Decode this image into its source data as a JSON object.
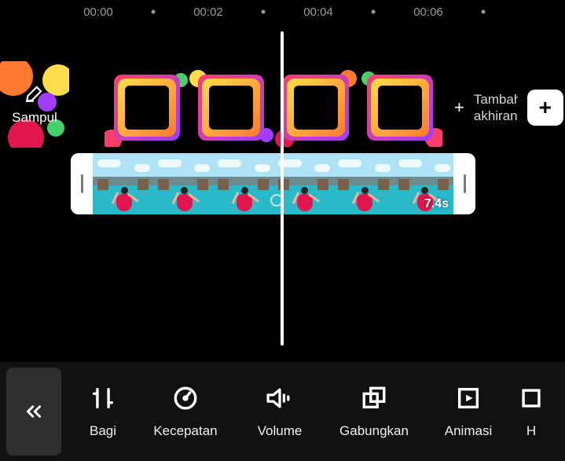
{
  "ruler": {
    "labels": [
      "00:00",
      "00:02",
      "00:04",
      "00:06"
    ],
    "dot": "•"
  },
  "cover": {
    "label": "Sampul"
  },
  "add_ending": {
    "text": "Tambah akhiran"
  },
  "clip": {
    "duration": "7.4s"
  },
  "toolbar": {
    "items": [
      {
        "label": "Bagi"
      },
      {
        "label": "Kecepatan"
      },
      {
        "label": "Volume"
      },
      {
        "label": "Gabungkan"
      },
      {
        "label": "Animasi"
      },
      {
        "label": "H"
      }
    ]
  }
}
